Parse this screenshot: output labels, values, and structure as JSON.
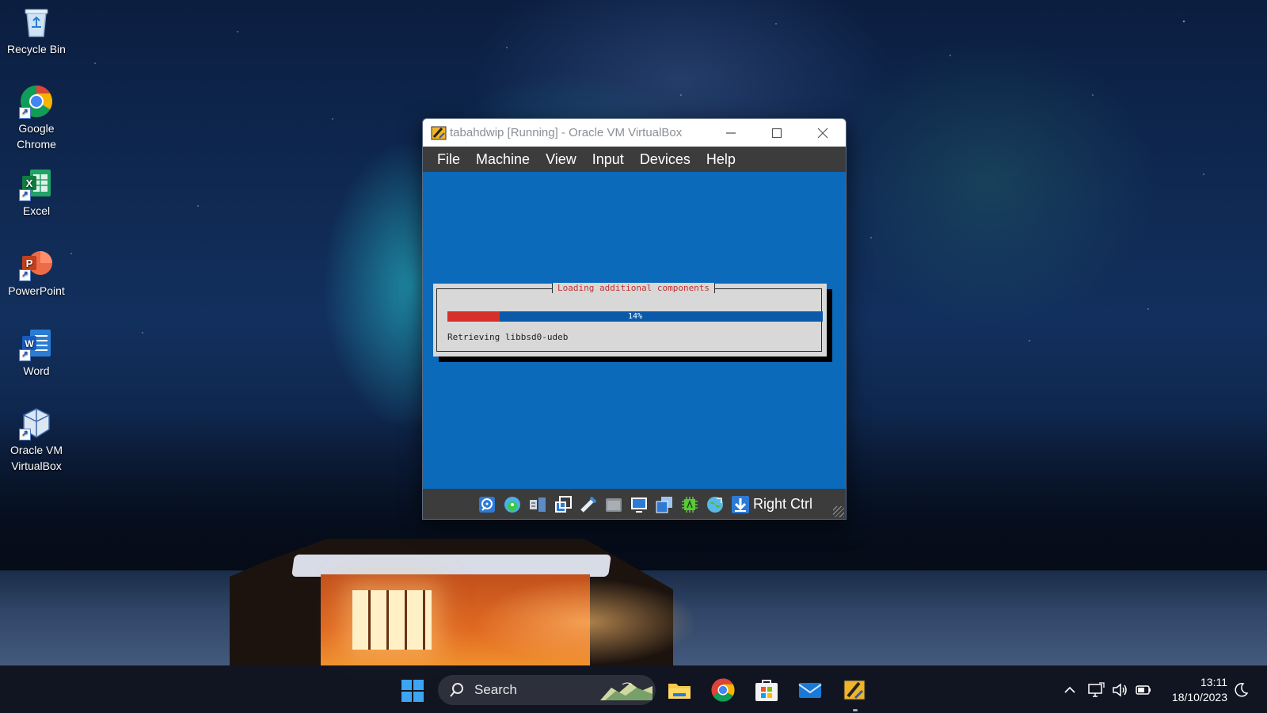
{
  "desktop": {
    "icons": [
      {
        "label": "Recycle Bin",
        "icon": "recycle-bin-icon"
      },
      {
        "label": "Google Chrome",
        "icon": "chrome-icon"
      },
      {
        "label": "Excel",
        "icon": "excel-icon"
      },
      {
        "label": "PowerPoint",
        "icon": "powerpoint-icon"
      },
      {
        "label": "Word",
        "icon": "word-icon"
      },
      {
        "label": "Oracle VM VirtualBox",
        "icon": "virtualbox-icon"
      }
    ]
  },
  "vbox": {
    "title": "tabahdwip [Running] - Oracle VM VirtualBox",
    "menu": [
      "File",
      "Machine",
      "View",
      "Input",
      "Devices",
      "Help"
    ],
    "installer": {
      "dialog_title": "Loading additional components",
      "progress_percent": 14,
      "progress_label": "14%",
      "status": "Retrieving libbsd0-udeb"
    },
    "statusbar": {
      "icons": [
        "hard-disk-icon",
        "optical-drive-icon",
        "audio-icon",
        "network-icon",
        "usb-icon",
        "shared-folders-icon",
        "display-icon",
        "video-capture-icon",
        "cpu-icon",
        "guest-additions-icon",
        "mouse-integration-icon"
      ],
      "host_key": "Right Ctrl"
    },
    "colors": {
      "vm_background": "#0b6ab9",
      "progress_fill": "#d6302b",
      "dialog_title": "#c4302b"
    }
  },
  "taskbar": {
    "search_label": "Search",
    "apps": [
      "file-explorer-icon",
      "chrome-icon",
      "microsoft-store-icon",
      "mail-icon",
      "virtualbox-icon"
    ],
    "tray": [
      "chevron-up-icon",
      "network-icon",
      "volume-icon",
      "battery-icon",
      "moon-icon"
    ],
    "time": "13:11",
    "date": "18/10/2023"
  }
}
